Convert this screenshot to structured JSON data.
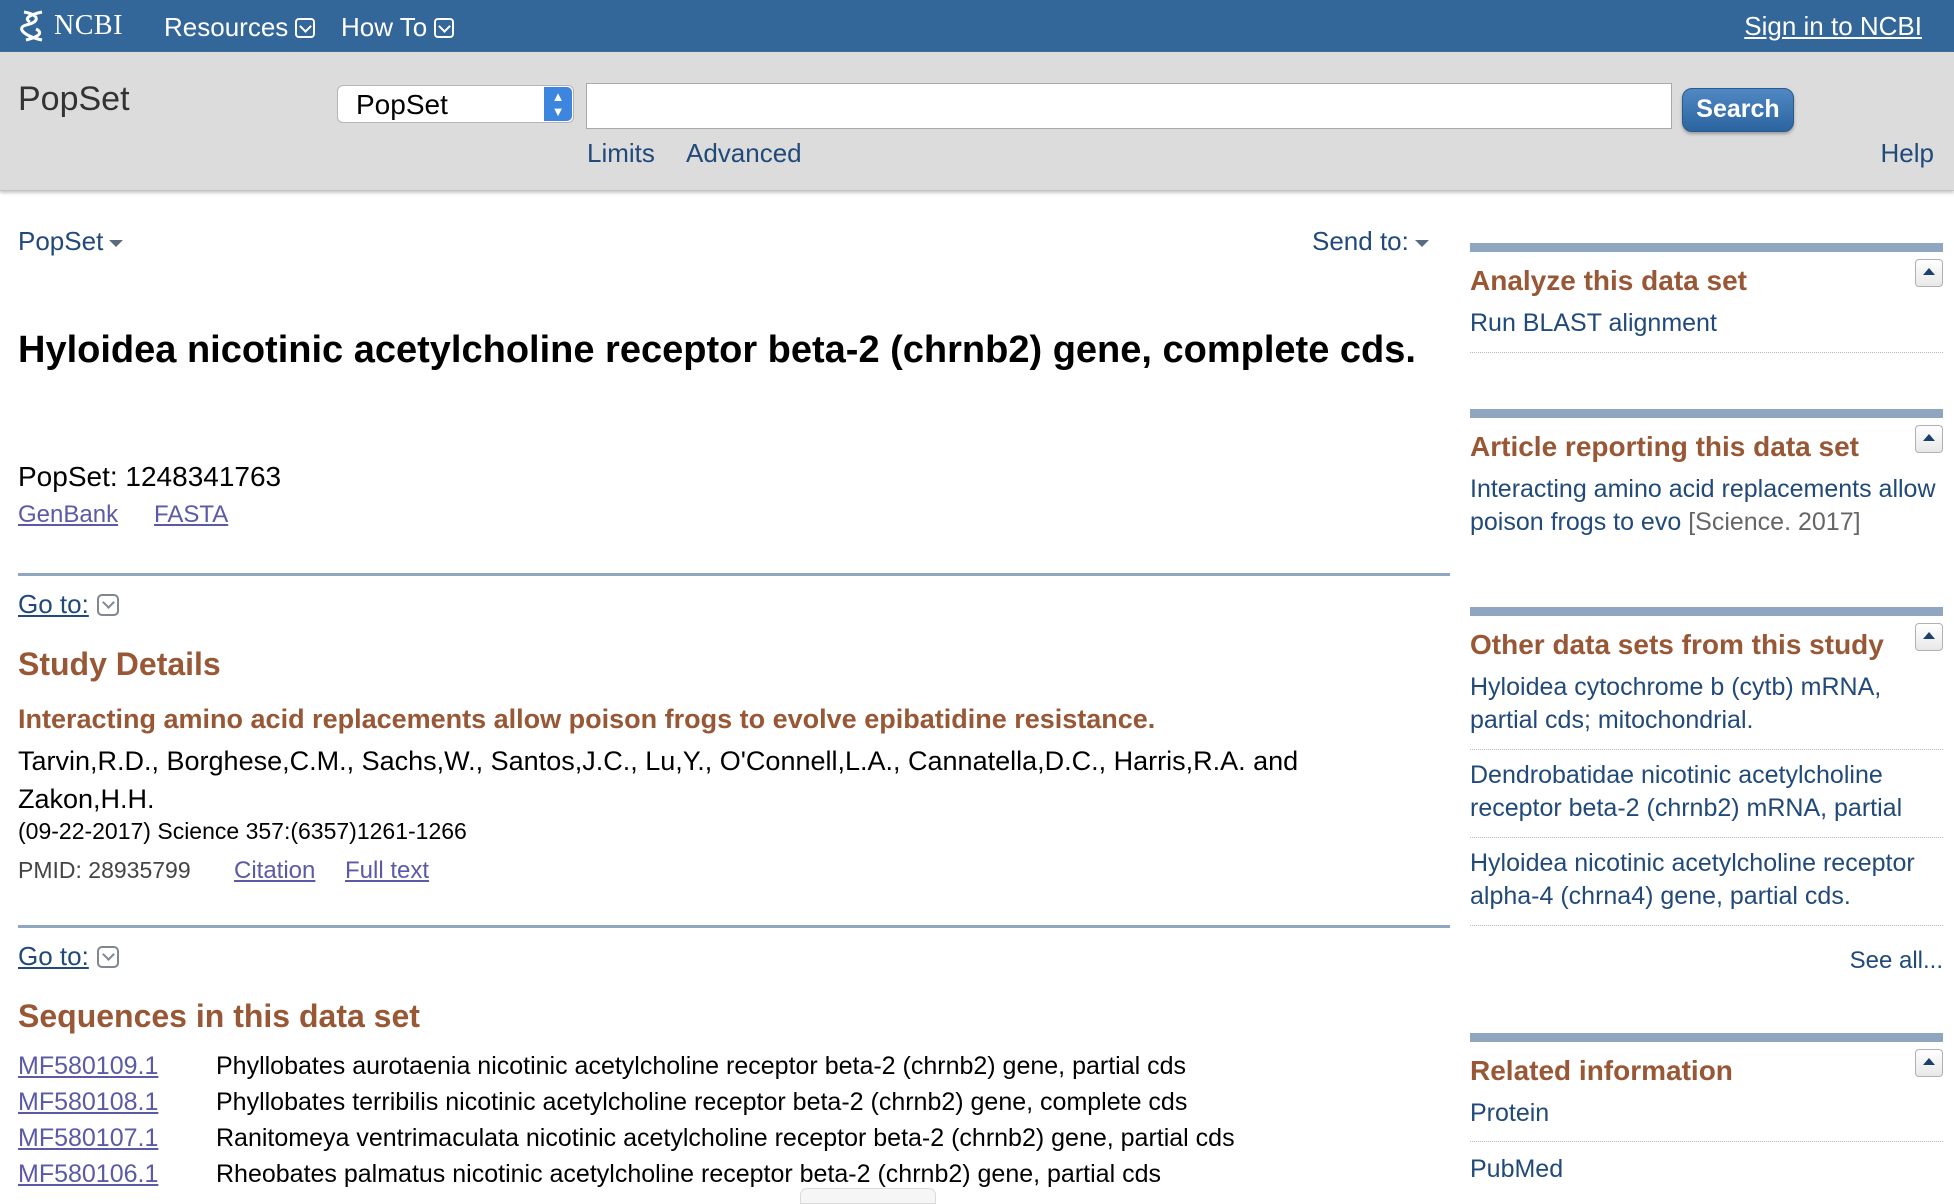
{
  "header": {
    "logo_text": "NCBI",
    "menu_resources": "Resources",
    "menu_howto": "How To",
    "signin": "Sign in to NCBI"
  },
  "search": {
    "db_label": "PopSet",
    "db_selected": "PopSet",
    "query": "",
    "button": "Search",
    "limits": "Limits",
    "advanced": "Advanced",
    "help": "Help"
  },
  "record": {
    "db_menu": "PopSet",
    "send_to": "Send to:",
    "title": "Hyloidea nicotinic acetylcholine receptor beta-2 (chrnb2) gene, complete cds.",
    "popset_id": "PopSet: 1248341763",
    "formats": [
      "GenBank",
      "FASTA"
    ],
    "goto_label": "Go to:"
  },
  "study": {
    "heading": "Study Details",
    "article_title": "Interacting amino acid replacements allow poison frogs to evolve epibatidine resistance.",
    "authors": "Tarvin,R.D., Borghese,C.M., Sachs,W., Santos,J.C., Lu,Y., O'Connell,L.A., Cannatella,D.C., Harris,R.A. and Zakon,H.H.",
    "citation": "(09-22-2017) Science 357:(6357)1261-1266",
    "pmid": "PMID: 28935799",
    "citation_link": "Citation",
    "fulltext_link": "Full text"
  },
  "sequences": {
    "heading": "Sequences in this data set",
    "rows": [
      {
        "acc": "MF580109.1",
        "desc": "Phyllobates aurotaenia nicotinic acetylcholine receptor beta-2 (chrnb2) gene, partial cds"
      },
      {
        "acc": "MF580108.1",
        "desc": "Phyllobates terribilis nicotinic acetylcholine receptor beta-2 (chrnb2) gene, complete cds"
      },
      {
        "acc": "MF580107.1",
        "desc": "Ranitomeya ventrimaculata nicotinic acetylcholine receptor beta-2 (chrnb2) gene, partial cds"
      },
      {
        "acc": "MF580106.1",
        "desc": "Rheobates palmatus nicotinic acetylcholine receptor beta-2 (chrnb2) gene, partial cds"
      }
    ]
  },
  "sidebar": {
    "analyze": {
      "title": "Analyze this data set",
      "link": "Run BLAST alignment"
    },
    "article": {
      "title": "Article reporting this data set",
      "link": "Interacting amino acid replacements allow poison frogs to evo",
      "source": "[Science. 2017]"
    },
    "other": {
      "title": "Other data sets from this study",
      "links": [
        "Hyloidea cytochrome b (cytb) mRNA, partial cds; mitochondrial.",
        "Dendrobatidae nicotinic acetylcholine receptor beta-2 (chrnb2) mRNA, partial",
        "Hyloidea nicotinic acetylcholine receptor alpha-4 (chrna4) gene, partial cds."
      ],
      "see_all": "See all..."
    },
    "related": {
      "title": "Related information",
      "links": [
        "Protein",
        "PubMed"
      ]
    }
  },
  "colors": {
    "header_bg": "#336699",
    "heading_brown": "#985735",
    "link_blue": "#214a7a",
    "rule_blue": "#8fa6c0"
  }
}
